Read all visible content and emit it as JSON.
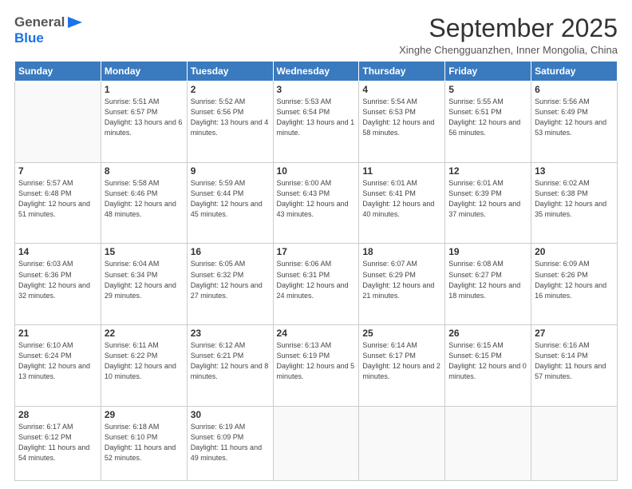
{
  "header": {
    "logo_general": "General",
    "logo_blue": "Blue",
    "month": "September 2025",
    "location": "Xinghe Chengguanzhen, Inner Mongolia, China"
  },
  "days_of_week": [
    "Sunday",
    "Monday",
    "Tuesday",
    "Wednesday",
    "Thursday",
    "Friday",
    "Saturday"
  ],
  "weeks": [
    [
      {
        "day": "",
        "sunrise": "",
        "sunset": "",
        "daylight": ""
      },
      {
        "day": "1",
        "sunrise": "Sunrise: 5:51 AM",
        "sunset": "Sunset: 6:57 PM",
        "daylight": "Daylight: 13 hours and 6 minutes."
      },
      {
        "day": "2",
        "sunrise": "Sunrise: 5:52 AM",
        "sunset": "Sunset: 6:56 PM",
        "daylight": "Daylight: 13 hours and 4 minutes."
      },
      {
        "day": "3",
        "sunrise": "Sunrise: 5:53 AM",
        "sunset": "Sunset: 6:54 PM",
        "daylight": "Daylight: 13 hours and 1 minute."
      },
      {
        "day": "4",
        "sunrise": "Sunrise: 5:54 AM",
        "sunset": "Sunset: 6:53 PM",
        "daylight": "Daylight: 12 hours and 58 minutes."
      },
      {
        "day": "5",
        "sunrise": "Sunrise: 5:55 AM",
        "sunset": "Sunset: 6:51 PM",
        "daylight": "Daylight: 12 hours and 56 minutes."
      },
      {
        "day": "6",
        "sunrise": "Sunrise: 5:56 AM",
        "sunset": "Sunset: 6:49 PM",
        "daylight": "Daylight: 12 hours and 53 minutes."
      }
    ],
    [
      {
        "day": "7",
        "sunrise": "Sunrise: 5:57 AM",
        "sunset": "Sunset: 6:48 PM",
        "daylight": "Daylight: 12 hours and 51 minutes."
      },
      {
        "day": "8",
        "sunrise": "Sunrise: 5:58 AM",
        "sunset": "Sunset: 6:46 PM",
        "daylight": "Daylight: 12 hours and 48 minutes."
      },
      {
        "day": "9",
        "sunrise": "Sunrise: 5:59 AM",
        "sunset": "Sunset: 6:44 PM",
        "daylight": "Daylight: 12 hours and 45 minutes."
      },
      {
        "day": "10",
        "sunrise": "Sunrise: 6:00 AM",
        "sunset": "Sunset: 6:43 PM",
        "daylight": "Daylight: 12 hours and 43 minutes."
      },
      {
        "day": "11",
        "sunrise": "Sunrise: 6:01 AM",
        "sunset": "Sunset: 6:41 PM",
        "daylight": "Daylight: 12 hours and 40 minutes."
      },
      {
        "day": "12",
        "sunrise": "Sunrise: 6:01 AM",
        "sunset": "Sunset: 6:39 PM",
        "daylight": "Daylight: 12 hours and 37 minutes."
      },
      {
        "day": "13",
        "sunrise": "Sunrise: 6:02 AM",
        "sunset": "Sunset: 6:38 PM",
        "daylight": "Daylight: 12 hours and 35 minutes."
      }
    ],
    [
      {
        "day": "14",
        "sunrise": "Sunrise: 6:03 AM",
        "sunset": "Sunset: 6:36 PM",
        "daylight": "Daylight: 12 hours and 32 minutes."
      },
      {
        "day": "15",
        "sunrise": "Sunrise: 6:04 AM",
        "sunset": "Sunset: 6:34 PM",
        "daylight": "Daylight: 12 hours and 29 minutes."
      },
      {
        "day": "16",
        "sunrise": "Sunrise: 6:05 AM",
        "sunset": "Sunset: 6:32 PM",
        "daylight": "Daylight: 12 hours and 27 minutes."
      },
      {
        "day": "17",
        "sunrise": "Sunrise: 6:06 AM",
        "sunset": "Sunset: 6:31 PM",
        "daylight": "Daylight: 12 hours and 24 minutes."
      },
      {
        "day": "18",
        "sunrise": "Sunrise: 6:07 AM",
        "sunset": "Sunset: 6:29 PM",
        "daylight": "Daylight: 12 hours and 21 minutes."
      },
      {
        "day": "19",
        "sunrise": "Sunrise: 6:08 AM",
        "sunset": "Sunset: 6:27 PM",
        "daylight": "Daylight: 12 hours and 18 minutes."
      },
      {
        "day": "20",
        "sunrise": "Sunrise: 6:09 AM",
        "sunset": "Sunset: 6:26 PM",
        "daylight": "Daylight: 12 hours and 16 minutes."
      }
    ],
    [
      {
        "day": "21",
        "sunrise": "Sunrise: 6:10 AM",
        "sunset": "Sunset: 6:24 PM",
        "daylight": "Daylight: 12 hours and 13 minutes."
      },
      {
        "day": "22",
        "sunrise": "Sunrise: 6:11 AM",
        "sunset": "Sunset: 6:22 PM",
        "daylight": "Daylight: 12 hours and 10 minutes."
      },
      {
        "day": "23",
        "sunrise": "Sunrise: 6:12 AM",
        "sunset": "Sunset: 6:21 PM",
        "daylight": "Daylight: 12 hours and 8 minutes."
      },
      {
        "day": "24",
        "sunrise": "Sunrise: 6:13 AM",
        "sunset": "Sunset: 6:19 PM",
        "daylight": "Daylight: 12 hours and 5 minutes."
      },
      {
        "day": "25",
        "sunrise": "Sunrise: 6:14 AM",
        "sunset": "Sunset: 6:17 PM",
        "daylight": "Daylight: 12 hours and 2 minutes."
      },
      {
        "day": "26",
        "sunrise": "Sunrise: 6:15 AM",
        "sunset": "Sunset: 6:15 PM",
        "daylight": "Daylight: 12 hours and 0 minutes."
      },
      {
        "day": "27",
        "sunrise": "Sunrise: 6:16 AM",
        "sunset": "Sunset: 6:14 PM",
        "daylight": "Daylight: 11 hours and 57 minutes."
      }
    ],
    [
      {
        "day": "28",
        "sunrise": "Sunrise: 6:17 AM",
        "sunset": "Sunset: 6:12 PM",
        "daylight": "Daylight: 11 hours and 54 minutes."
      },
      {
        "day": "29",
        "sunrise": "Sunrise: 6:18 AM",
        "sunset": "Sunset: 6:10 PM",
        "daylight": "Daylight: 11 hours and 52 minutes."
      },
      {
        "day": "30",
        "sunrise": "Sunrise: 6:19 AM",
        "sunset": "Sunset: 6:09 PM",
        "daylight": "Daylight: 11 hours and 49 minutes."
      },
      {
        "day": "",
        "sunrise": "",
        "sunset": "",
        "daylight": ""
      },
      {
        "day": "",
        "sunrise": "",
        "sunset": "",
        "daylight": ""
      },
      {
        "day": "",
        "sunrise": "",
        "sunset": "",
        "daylight": ""
      },
      {
        "day": "",
        "sunrise": "",
        "sunset": "",
        "daylight": ""
      }
    ]
  ]
}
